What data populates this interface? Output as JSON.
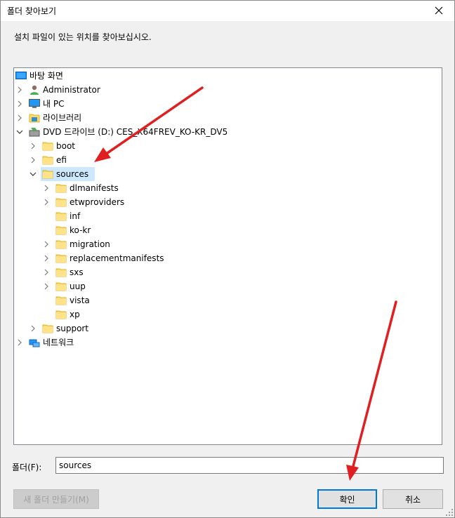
{
  "window": {
    "title": "폴더 찾아보기",
    "instruction": "설치 파일이 있는 위치를 찾아보십시오."
  },
  "tree": [
    {
      "label": "바탕 화면",
      "icon": "desktop-icon",
      "level": 0,
      "expander": "none"
    },
    {
      "label": "Administrator",
      "icon": "user-icon",
      "level": 1,
      "expander": "collapsed"
    },
    {
      "label": "내 PC",
      "icon": "computer-icon",
      "level": 1,
      "expander": "collapsed"
    },
    {
      "label": "라이브러리",
      "icon": "library-icon",
      "level": 1,
      "expander": "collapsed"
    },
    {
      "label": "DVD 드라이브 (D:) CES_X64FREV_KO-KR_DV5",
      "icon": "dvd-drive-icon",
      "level": 1,
      "expander": "expanded"
    },
    {
      "label": "boot",
      "icon": "folder-icon",
      "level": 2,
      "expander": "collapsed"
    },
    {
      "label": "efi",
      "icon": "folder-icon",
      "level": 2,
      "expander": "collapsed"
    },
    {
      "label": "sources",
      "icon": "folder-icon",
      "level": 2,
      "expander": "expanded",
      "selected": true
    },
    {
      "label": "dlmanifests",
      "icon": "folder-icon",
      "level": 3,
      "expander": "collapsed"
    },
    {
      "label": "etwproviders",
      "icon": "folder-icon",
      "level": 3,
      "expander": "collapsed"
    },
    {
      "label": "inf",
      "icon": "folder-icon",
      "level": 3,
      "expander": "none"
    },
    {
      "label": "ko-kr",
      "icon": "folder-icon",
      "level": 3,
      "expander": "none"
    },
    {
      "label": "migration",
      "icon": "folder-icon",
      "level": 3,
      "expander": "collapsed"
    },
    {
      "label": "replacementmanifests",
      "icon": "folder-icon",
      "level": 3,
      "expander": "collapsed"
    },
    {
      "label": "sxs",
      "icon": "folder-icon",
      "level": 3,
      "expander": "collapsed"
    },
    {
      "label": "uup",
      "icon": "folder-icon",
      "level": 3,
      "expander": "collapsed"
    },
    {
      "label": "vista",
      "icon": "folder-icon",
      "level": 3,
      "expander": "none"
    },
    {
      "label": "xp",
      "icon": "folder-icon",
      "level": 3,
      "expander": "none"
    },
    {
      "label": "support",
      "icon": "folder-icon",
      "level": 2,
      "expander": "collapsed"
    },
    {
      "label": "네트워크",
      "icon": "network-icon",
      "level": 1,
      "expander": "collapsed"
    }
  ],
  "folder_field": {
    "label": "폴더(F):",
    "value": "sources"
  },
  "buttons": {
    "new_folder": "새 폴더 만들기(M)",
    "ok": "확인",
    "cancel": "취소"
  },
  "colors": {
    "selection": "#cce8ff",
    "folder": "#ffd966",
    "accent": "#0078d7",
    "annotation_arrow": "#e02020"
  }
}
